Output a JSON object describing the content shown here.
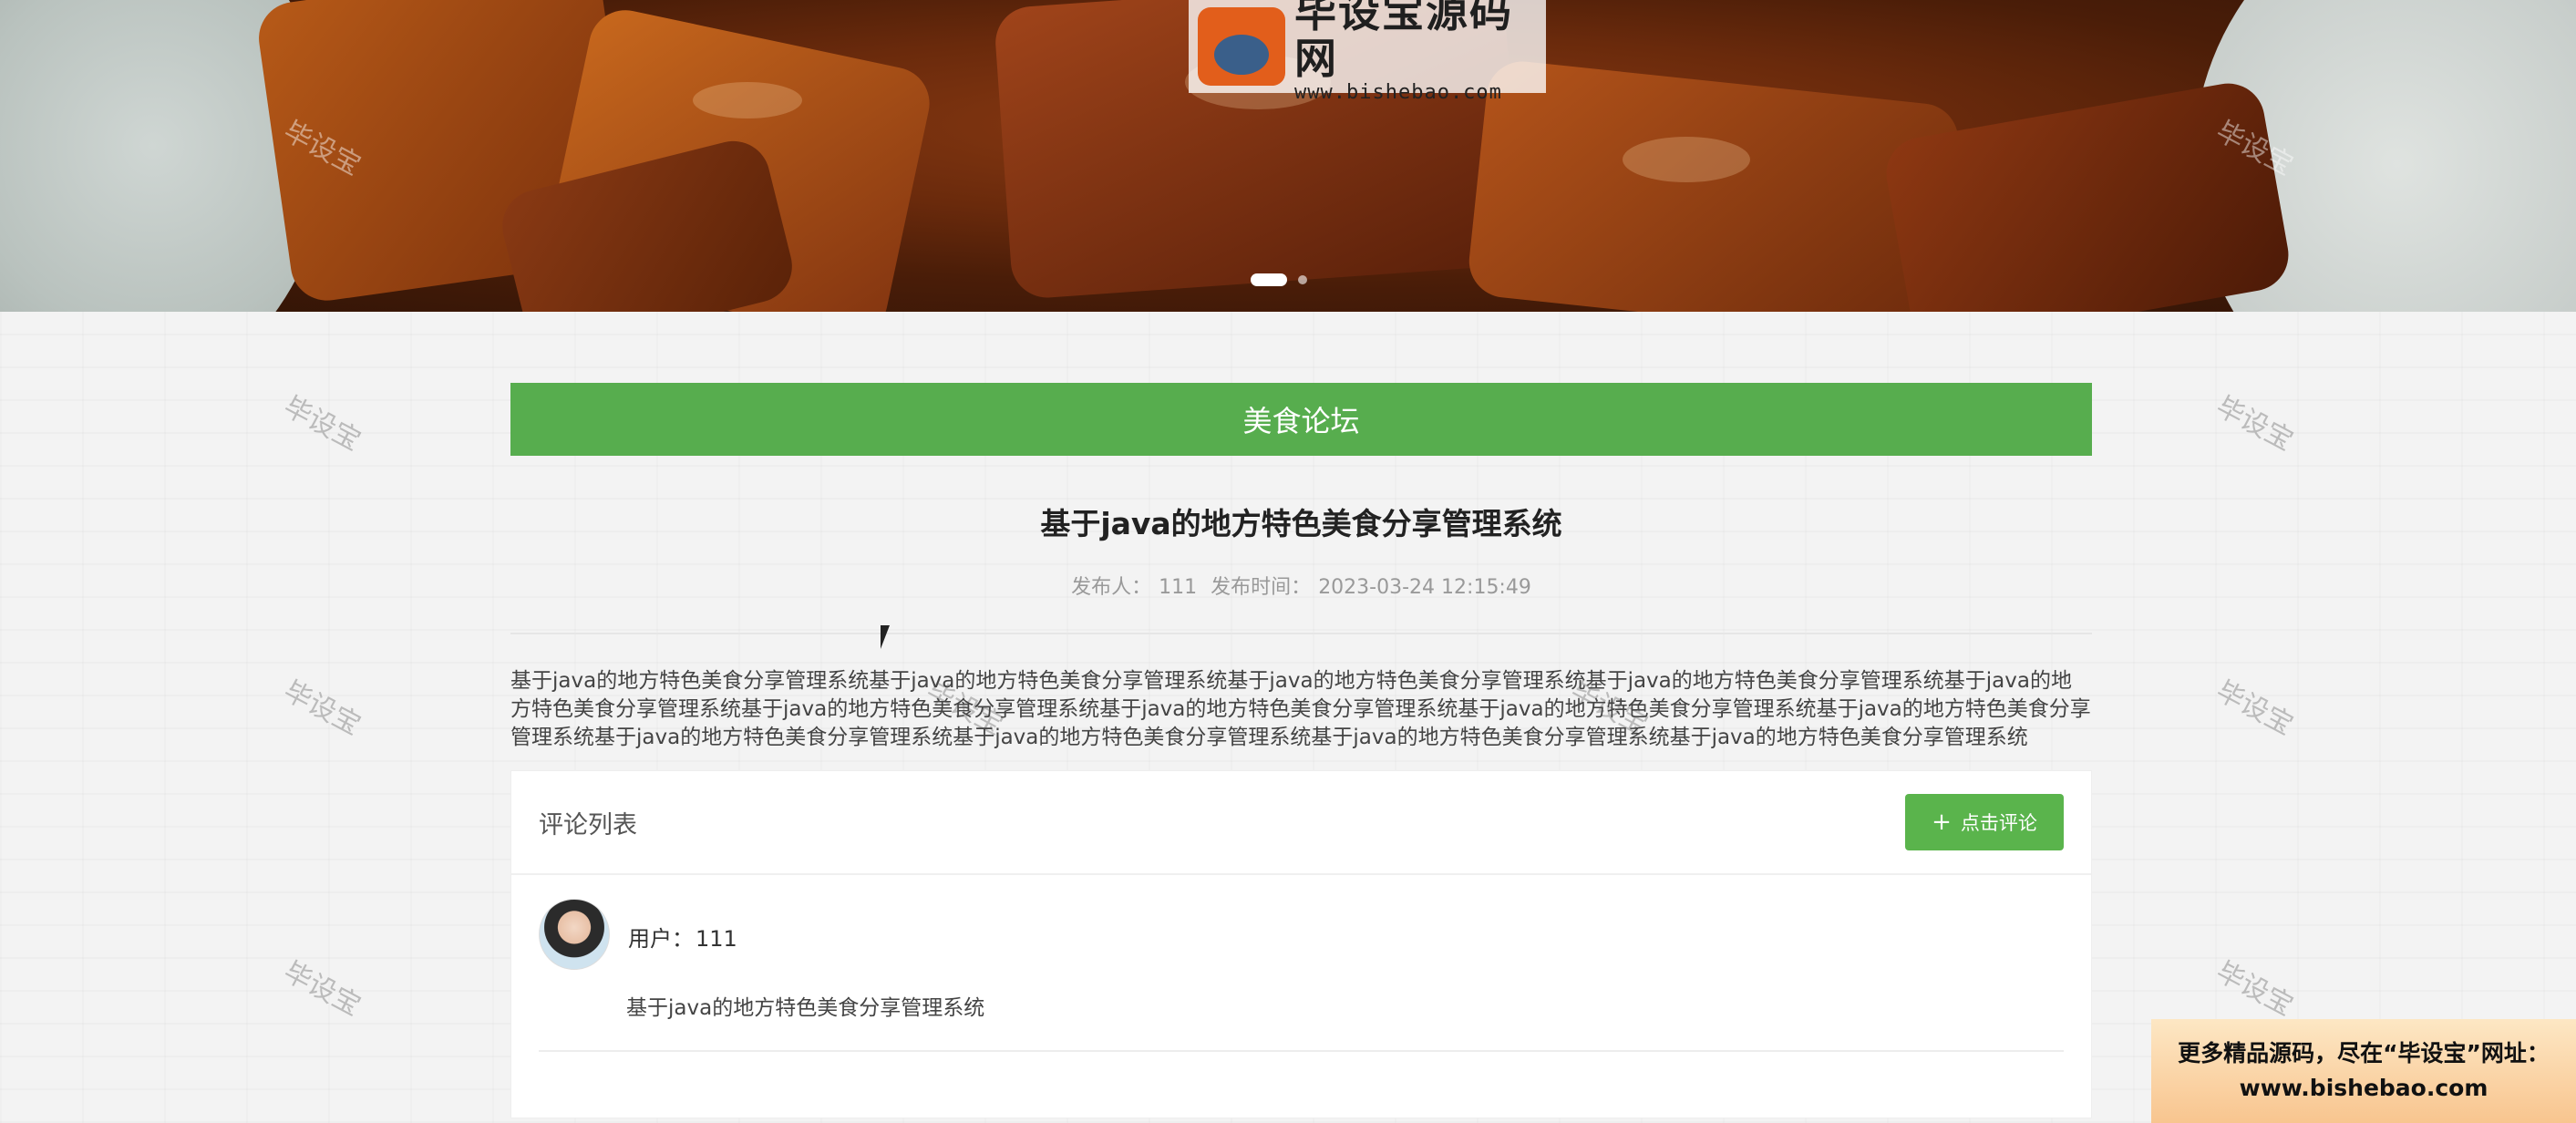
{
  "banner": {
    "logo_cn": "毕设宝源码网",
    "logo_url": "www.bishebao.com"
  },
  "watermark_text": "毕设宝",
  "forum": {
    "section_title": "美食论坛"
  },
  "post": {
    "title": "基于java的地方特色美食分享管理系统",
    "author_label": "发布人：",
    "author": "111",
    "time_label": "发布时间：",
    "time": "2023-03-24 12:15:49",
    "body": "基于java的地方特色美食分享管理系统基于java的地方特色美食分享管理系统基于java的地方特色美食分享管理系统基于java的地方特色美食分享管理系统基于java的地方特色美食分享管理系统基于java的地方特色美食分享管理系统基于java的地方特色美食分享管理系统基于java的地方特色美食分享管理系统基于java的地方特色美食分享管理系统基于java的地方特色美食分享管理系统基于java的地方特色美食分享管理系统基于java的地方特色美食分享管理系统基于java的地方特色美食分享管理系统"
  },
  "comments": {
    "title": "评论列表",
    "add_button_label": "点击评论",
    "items": [
      {
        "user_label": "用户：",
        "user": "111",
        "text": "基于java的地方特色美食分享管理系统"
      }
    ]
  },
  "corner_ad": {
    "line1": "更多精品源码，尽在“毕设宝”网址：",
    "line2": "www.bishebao.com"
  },
  "colors": {
    "accent_green": "#57ad4e",
    "button_green": "#5ab44c"
  }
}
